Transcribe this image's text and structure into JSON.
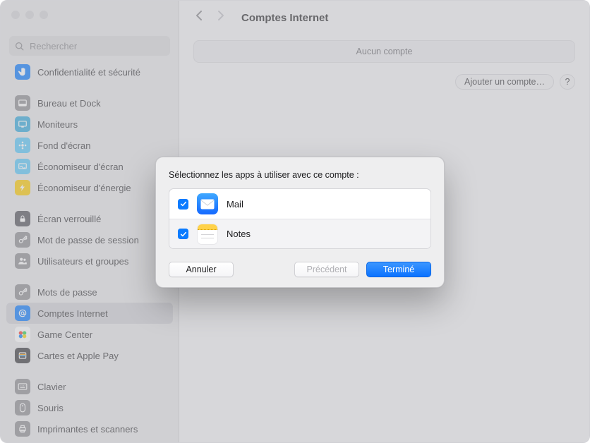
{
  "search": {
    "placeholder": "Rechercher"
  },
  "sidebar": [
    {
      "label": "Confidentialité et sécurité",
      "icon": "hand",
      "bg": "#0a7bff"
    },
    {
      "gap": true
    },
    {
      "label": "Bureau et Dock",
      "icon": "dock",
      "bg": "#8e8e93"
    },
    {
      "label": "Moniteurs",
      "icon": "display",
      "bg": "#34aadc"
    },
    {
      "label": "Fond d'écran",
      "icon": "flower",
      "bg": "#5ac8fa"
    },
    {
      "label": "Économiseur d'écran",
      "icon": "saver",
      "bg": "#5ac8fa"
    },
    {
      "label": "Économiseur d'énergie",
      "icon": "bolt",
      "bg": "#ffcc00"
    },
    {
      "gap": true
    },
    {
      "label": "Écran verrouillé",
      "icon": "lock",
      "bg": "#52525a"
    },
    {
      "label": "Mot de passe de session",
      "icon": "key",
      "bg": "#8e8e93"
    },
    {
      "label": "Utilisateurs et groupes",
      "icon": "users",
      "bg": "#8e8e93"
    },
    {
      "gap": true
    },
    {
      "label": "Mots de passe",
      "icon": "key",
      "bg": "#8e8e93"
    },
    {
      "label": "Comptes Internet",
      "icon": "at",
      "bg": "#0a7bff",
      "selected": true
    },
    {
      "label": "Game Center",
      "icon": "game",
      "bg": "#ffffff"
    },
    {
      "label": "Cartes et Apple Pay",
      "icon": "wallet",
      "bg": "#3a3a3c"
    },
    {
      "gap": true
    },
    {
      "label": "Clavier",
      "icon": "kbd",
      "bg": "#8e8e93"
    },
    {
      "label": "Souris",
      "icon": "mouse",
      "bg": "#8e8e93"
    },
    {
      "label": "Imprimantes et scanners",
      "icon": "print",
      "bg": "#8e8e93"
    }
  ],
  "header": {
    "title": "Comptes Internet"
  },
  "pane": {
    "label": "Aucun compte"
  },
  "actions": {
    "add": "Ajouter un compte…",
    "help": "?"
  },
  "modal": {
    "title": "Sélectionnez les apps à utiliser avec ce compte :",
    "apps": [
      {
        "label": "Mail",
        "checked": true
      },
      {
        "label": "Notes",
        "checked": true
      }
    ],
    "buttons": {
      "cancel": "Annuler",
      "prev": "Précédent",
      "done": "Terminé"
    }
  }
}
